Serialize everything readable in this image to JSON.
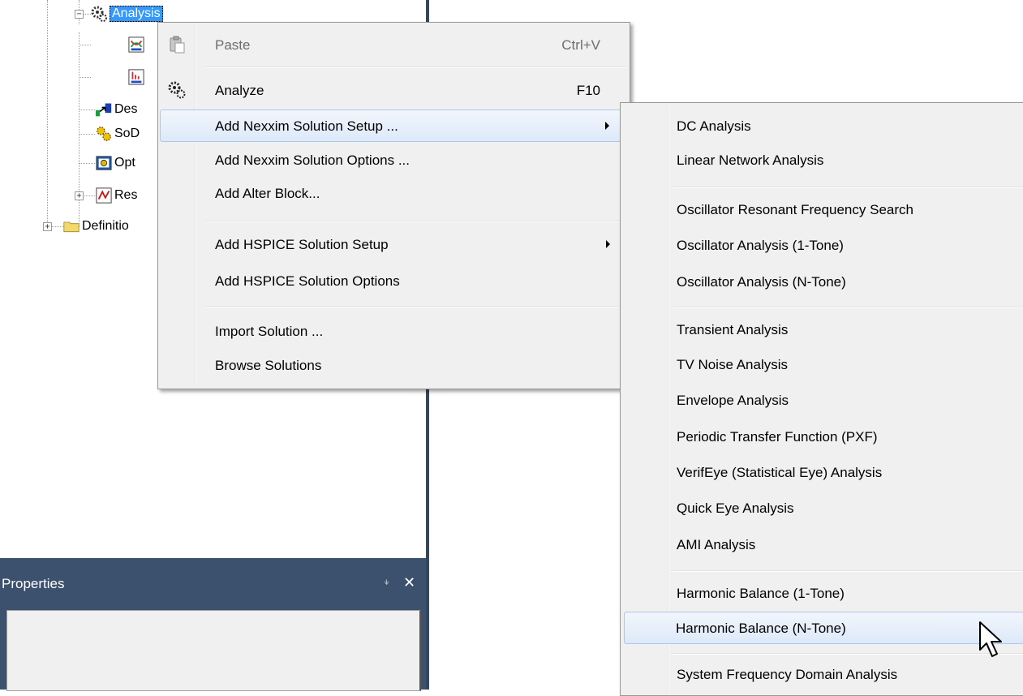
{
  "tree": {
    "items": [
      {
        "label": "Analysis",
        "selected": true
      },
      {
        "label": ""
      },
      {
        "label": ""
      },
      {
        "label": "Des"
      },
      {
        "label": "SoD"
      },
      {
        "label": "Opt"
      },
      {
        "label": "Res"
      },
      {
        "label": "Definitio"
      }
    ],
    "expanders": {
      "collapse": "−",
      "expand": "+"
    }
  },
  "properties": {
    "title": "Properties",
    "pin_icon": "⍖",
    "close_icon": "✕"
  },
  "context_menu": {
    "items": [
      {
        "label": "Paste",
        "shortcut": "Ctrl+V",
        "icon": "paste-icon",
        "disabled": true
      },
      {
        "label": "Analyze",
        "shortcut": "F10",
        "icon": "analyze-gears-icon"
      },
      {
        "label": "Add Nexxim Solution Setup ...",
        "submenu": true,
        "highlighted": true
      },
      {
        "label": "Add Nexxim Solution Options ..."
      },
      {
        "label": "Add Alter Block..."
      },
      {
        "label": "Add HSPICE Solution Setup",
        "submenu": true
      },
      {
        "label": "Add HSPICE Solution Options"
      },
      {
        "label": "Import Solution ..."
      },
      {
        "label": "Browse Solutions"
      }
    ]
  },
  "submenu": {
    "items": [
      {
        "label": "DC Analysis"
      },
      {
        "label": "Linear Network Analysis"
      },
      {
        "label": "Oscillator Resonant Frequency Search"
      },
      {
        "label": "Oscillator Analysis (1-Tone)"
      },
      {
        "label": "Oscillator Analysis (N-Tone)"
      },
      {
        "label": "Transient Analysis"
      },
      {
        "label": "TV Noise Analysis"
      },
      {
        "label": "Envelope Analysis"
      },
      {
        "label": "Periodic Transfer Function (PXF)"
      },
      {
        "label": "VerifEye (Statistical Eye) Analysis"
      },
      {
        "label": "Quick Eye Analysis"
      },
      {
        "label": "AMI Analysis"
      },
      {
        "label": "Harmonic Balance (1-Tone)"
      },
      {
        "label": "Harmonic Balance (N-Tone)",
        "highlighted": true
      },
      {
        "label": "System Frequency Domain Analysis"
      }
    ]
  },
  "colors": {
    "panel_header": "#3c516d",
    "selection": "#3399ff",
    "menu_bg": "#f0f0f0",
    "hover_border": "#aac7ec"
  }
}
